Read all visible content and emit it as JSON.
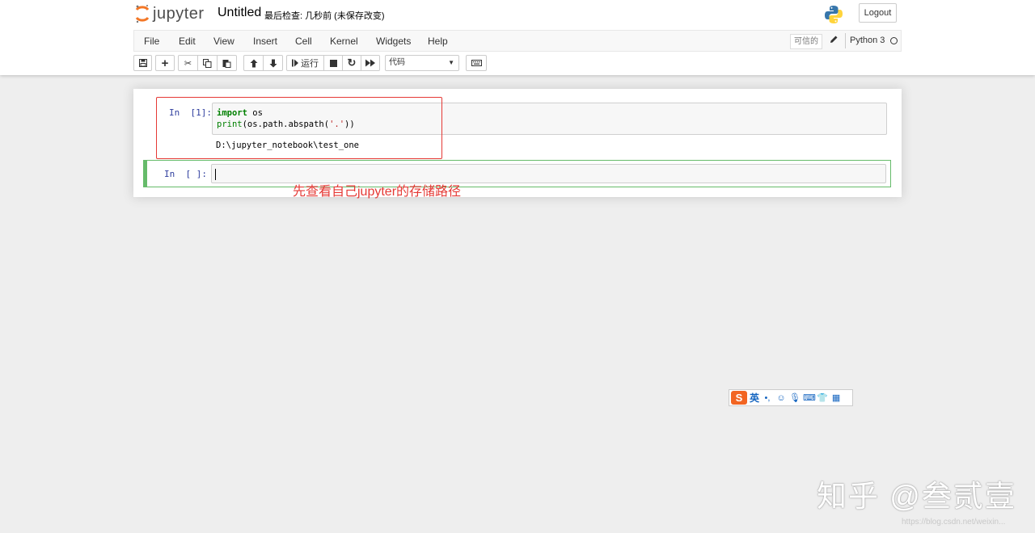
{
  "header": {
    "logo_text": "jupyter",
    "notebook_name": "Untitled",
    "checkpoint": "最后检查: 几秒前  (未保存改变)",
    "logout_label": "Logout",
    "python_logo_icon": "python-logo-icon"
  },
  "menubar": {
    "items": [
      "File",
      "Edit",
      "View",
      "Insert",
      "Cell",
      "Kernel",
      "Widgets",
      "Help"
    ],
    "trusted_label": "可信的",
    "kernel_name": "Python 3"
  },
  "toolbar": {
    "run_label": "运行",
    "cell_type": "代码",
    "icons": [
      "save-icon",
      "plus-icon",
      "cut-icon",
      "copy-icon",
      "paste-icon",
      "arrow-up-icon",
      "arrow-down-icon",
      "step-forward-icon",
      "stop-icon",
      "refresh-icon",
      "fast-forward-icon",
      "keyboard-icon"
    ]
  },
  "cells": [
    {
      "prompt": "In  [1]:",
      "code": [
        "import os",
        "print(os.path.abspath('.'))"
      ],
      "output": "D:\\jupyter_notebook\\test_one"
    },
    {
      "prompt": "In  [ ]:",
      "code": []
    }
  ],
  "annotation": {
    "text": "先查看自己jupyter的存储路径",
    "color": "#e53935"
  },
  "ime": {
    "label": "英",
    "brand": "S"
  },
  "watermark": {
    "text": "知乎 @叁贰壹",
    "url": "https://blog.csdn.net/weixin..."
  },
  "colors": {
    "prompt": "#303f9f",
    "keyword": "#008000",
    "string": "#ba2121",
    "selected_cell": "#66bb6a"
  }
}
